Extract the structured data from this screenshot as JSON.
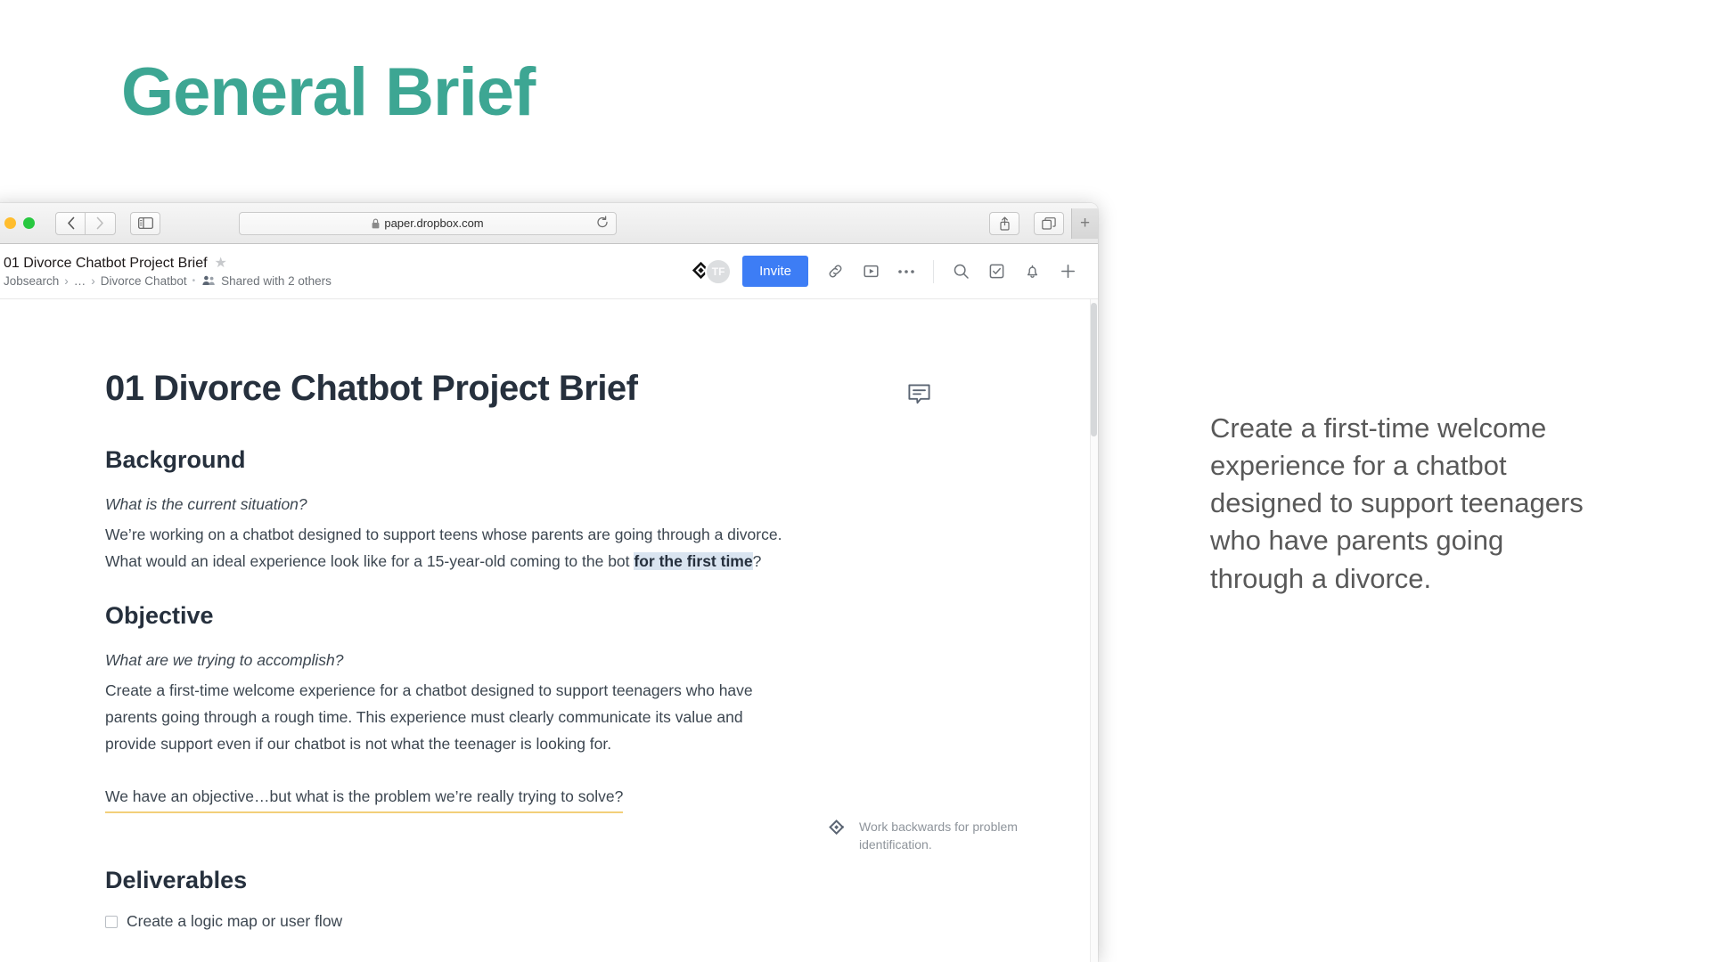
{
  "slide": {
    "title": "General Brief",
    "title_color": "#3da693",
    "callout": "Create a first-time welcome experience for a chatbot designed to support teenagers who have parents going through a divorce."
  },
  "browser": {
    "url": "paper.dropbox.com",
    "lock_icon": "lock-icon",
    "back_icon": "chevron-left-icon",
    "forward_icon": "chevron-right-icon",
    "sidebar_icon": "sidebar-toggle-icon",
    "reload_icon": "reload-icon",
    "share_icon": "share-icon",
    "tabs_icon": "show-tabs-icon",
    "newtab_label": "+",
    "traffic_lights": [
      "close-red",
      "minimize-yellow",
      "zoom-green"
    ]
  },
  "app_header": {
    "doc_title": "01 Divorce Chatbot Project Brief",
    "star_glyph": "★",
    "breadcrumb": {
      "root": "Jobsearch",
      "sep1": "›",
      "ellipsis": "…",
      "sep2": "›",
      "folder": "Divorce Chatbot",
      "dot": "•",
      "shared_text": "Shared with 2 others"
    },
    "avatars": [
      {
        "name": "dropbox-logo-avatar",
        "initials": ""
      },
      {
        "name": "user-avatar-tf",
        "initials": "TF"
      }
    ],
    "invite_label": "Invite",
    "invite_color": "#3d7df5",
    "icons": [
      "link-icon",
      "play-icon",
      "more-icon",
      "search-icon",
      "tasks-icon",
      "bell-icon",
      "plus-icon"
    ]
  },
  "document": {
    "h1": "01 Divorce Chatbot Project Brief",
    "sections": [
      {
        "heading": "Background",
        "prompt": "What is the current situation?",
        "body_before": "We’re working on a chatbot designed to support teens whose parents are going through a divorce. What would an ideal experience look like for a 15-year-old coming to the bot ",
        "highlight": "for the first time",
        "body_after": "?"
      },
      {
        "heading": "Objective",
        "prompt": "What are we trying to accomplish?",
        "body": "Create a first-time welcome experience for a chatbot designed to support teenagers who have parents going through a rough time. This experience must clearly communicate its value and provide support even if our chatbot is not what the teenager is looking for."
      }
    ],
    "question_line": "We have an objective…but what is the problem we’re really trying to solve?",
    "question_underline_color": "#f2cf7a",
    "deliverables_heading": "Deliverables",
    "deliverables": [
      {
        "checked": false,
        "label": "Create a logic map or user flow"
      }
    ],
    "annotation": "Work backwards for problem identification.",
    "comment_icon": "comment-bubble-icon"
  }
}
